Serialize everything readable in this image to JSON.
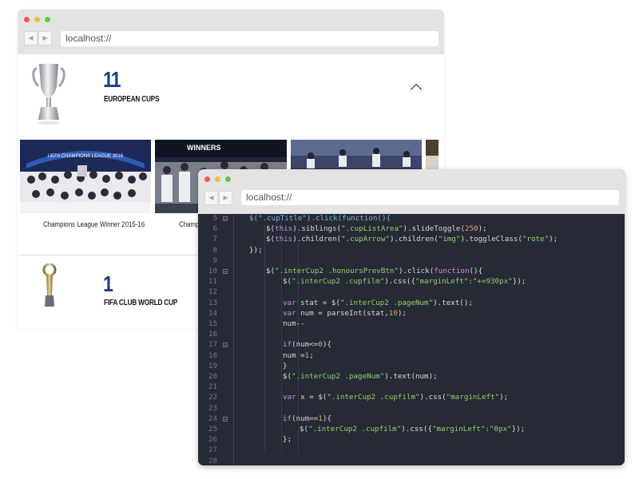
{
  "back_window": {
    "url": "localhost://",
    "nav": {
      "back_icon": "◀",
      "forward_icon": "▶"
    },
    "cups": [
      {
        "count": "11",
        "title": "EUROPEAN CUPS"
      },
      {
        "count": "1",
        "title": "FIFA CLUB WORLD CUP"
      }
    ],
    "photo_captions": [
      "Champions League Winner 2015-16",
      "Champio"
    ],
    "photo_banners": [
      "UEFA CHAMPIONS LEAGUE 2016",
      "WINNERS"
    ]
  },
  "front_window": {
    "url": "localhost://",
    "nav": {
      "back_icon": "◀",
      "forward_icon": "▶"
    },
    "code_lines": [
      {
        "n": "5",
        "fold": true,
        "indent": 0,
        "tokens": [
          [
            "fn",
            "$(\".cupTitle\").click(function(){"
          ]
        ]
      },
      {
        "n": "6",
        "fold": false,
        "indent": 1,
        "tokens": [
          [
            "pl",
            "$("
          ],
          [
            "kw",
            "this"
          ],
          [
            "pl",
            ").siblings("
          ],
          [
            "str",
            "\".cupListArea\""
          ],
          [
            "pl",
            ").slideToggle("
          ],
          [
            "num",
            "250"
          ],
          [
            "pl",
            ");"
          ]
        ]
      },
      {
        "n": "7",
        "fold": false,
        "indent": 1,
        "tokens": [
          [
            "pl",
            "$("
          ],
          [
            "kw",
            "this"
          ],
          [
            "pl",
            ").children("
          ],
          [
            "str",
            "\".cupArrow\""
          ],
          [
            "pl",
            ").children("
          ],
          [
            "str",
            "\"img\""
          ],
          [
            "pl",
            ").toggleClass("
          ],
          [
            "str",
            "\"rote\""
          ],
          [
            "pl",
            ");"
          ]
        ]
      },
      {
        "n": "8",
        "fold": false,
        "indent": 0,
        "tokens": [
          [
            "pl",
            "});"
          ]
        ]
      },
      {
        "n": "9",
        "fold": false,
        "indent": 0,
        "tokens": []
      },
      {
        "n": "10",
        "fold": true,
        "indent": 1,
        "tokens": [
          [
            "pl",
            "$("
          ],
          [
            "str",
            "\".interCup2 .honoursPrevBtn\""
          ],
          [
            "pl",
            ").click("
          ],
          [
            "kw",
            "function"
          ],
          [
            "pl",
            "(){"
          ]
        ]
      },
      {
        "n": "11",
        "fold": false,
        "indent": 2,
        "tokens": [
          [
            "pl",
            "$("
          ],
          [
            "str",
            "\".interCup2 .cupfilm\""
          ],
          [
            "pl",
            ").css({"
          ],
          [
            "str",
            "\"marginLeft\":\"+=930px\""
          ],
          [
            "pl",
            "});"
          ]
        ]
      },
      {
        "n": "12",
        "fold": false,
        "indent": 0,
        "tokens": []
      },
      {
        "n": "13",
        "fold": false,
        "indent": 2,
        "tokens": [
          [
            "kw",
            "var"
          ],
          [
            "pl",
            " stat = $("
          ],
          [
            "str",
            "\".interCup2 .pageNum\""
          ],
          [
            "pl",
            ").text();"
          ]
        ]
      },
      {
        "n": "14",
        "fold": false,
        "indent": 2,
        "tokens": [
          [
            "kw",
            "var"
          ],
          [
            "pl",
            " num = parseInt(stat,"
          ],
          [
            "num",
            "10"
          ],
          [
            "pl",
            ");"
          ]
        ]
      },
      {
        "n": "15",
        "fold": false,
        "indent": 2,
        "tokens": [
          [
            "pl",
            "num--"
          ]
        ]
      },
      {
        "n": "16",
        "fold": false,
        "indent": 0,
        "tokens": []
      },
      {
        "n": "17",
        "fold": true,
        "indent": 2,
        "tokens": [
          [
            "kw",
            "if"
          ],
          [
            "pl",
            "(num<="
          ],
          [
            "num",
            "0"
          ],
          [
            "pl",
            "){"
          ]
        ]
      },
      {
        "n": "18",
        "fold": false,
        "indent": 2,
        "tokens": [
          [
            "pl",
            "num ="
          ],
          [
            "num",
            "1"
          ],
          [
            "pl",
            ";"
          ]
        ]
      },
      {
        "n": "19",
        "fold": false,
        "indent": 2,
        "tokens": [
          [
            "pl",
            "}"
          ]
        ]
      },
      {
        "n": "20",
        "fold": false,
        "indent": 2,
        "tokens": [
          [
            "pl",
            "$("
          ],
          [
            "str",
            "\".interCup2 .pageNum\""
          ],
          [
            "pl",
            ").text(num);"
          ]
        ]
      },
      {
        "n": "21",
        "fold": false,
        "indent": 0,
        "tokens": []
      },
      {
        "n": "22",
        "fold": false,
        "indent": 2,
        "tokens": [
          [
            "kw",
            "var"
          ],
          [
            "pl",
            " x = $("
          ],
          [
            "str",
            "\".interCup2 .cupfilm\""
          ],
          [
            "pl",
            ").css("
          ],
          [
            "str",
            "\"marginLeft\""
          ],
          [
            "pl",
            ");"
          ]
        ]
      },
      {
        "n": "23",
        "fold": false,
        "indent": 0,
        "tokens": []
      },
      {
        "n": "24",
        "fold": true,
        "indent": 2,
        "tokens": [
          [
            "kw",
            "if"
          ],
          [
            "pl",
            "(num=="
          ],
          [
            "num",
            "1"
          ],
          [
            "pl",
            "){"
          ]
        ]
      },
      {
        "n": "25",
        "fold": false,
        "indent": 3,
        "tokens": [
          [
            "pl",
            "$("
          ],
          [
            "str",
            "\".interCup2 .cupfilm\""
          ],
          [
            "pl",
            ").css({"
          ],
          [
            "str",
            "\"marginLeft\":\"0px\""
          ],
          [
            "pl",
            "});"
          ]
        ]
      },
      {
        "n": "26",
        "fold": false,
        "indent": 2,
        "tokens": [
          [
            "pl",
            "};"
          ]
        ]
      },
      {
        "n": "27",
        "fold": false,
        "indent": 0,
        "tokens": []
      },
      {
        "n": "28",
        "fold": false,
        "indent": 0,
        "tokens": []
      }
    ],
    "token_colors": {
      "fn": "#7fb3e0",
      "str": "#9bcb71",
      "num": "#e0a46a",
      "kw": "#c58fdd",
      "pl": "#d6d9de"
    }
  },
  "colors": {
    "accent_blue": "#1c3c8f",
    "editor_bg": "#252a34",
    "chrome_bg": "#e3e3e3"
  }
}
